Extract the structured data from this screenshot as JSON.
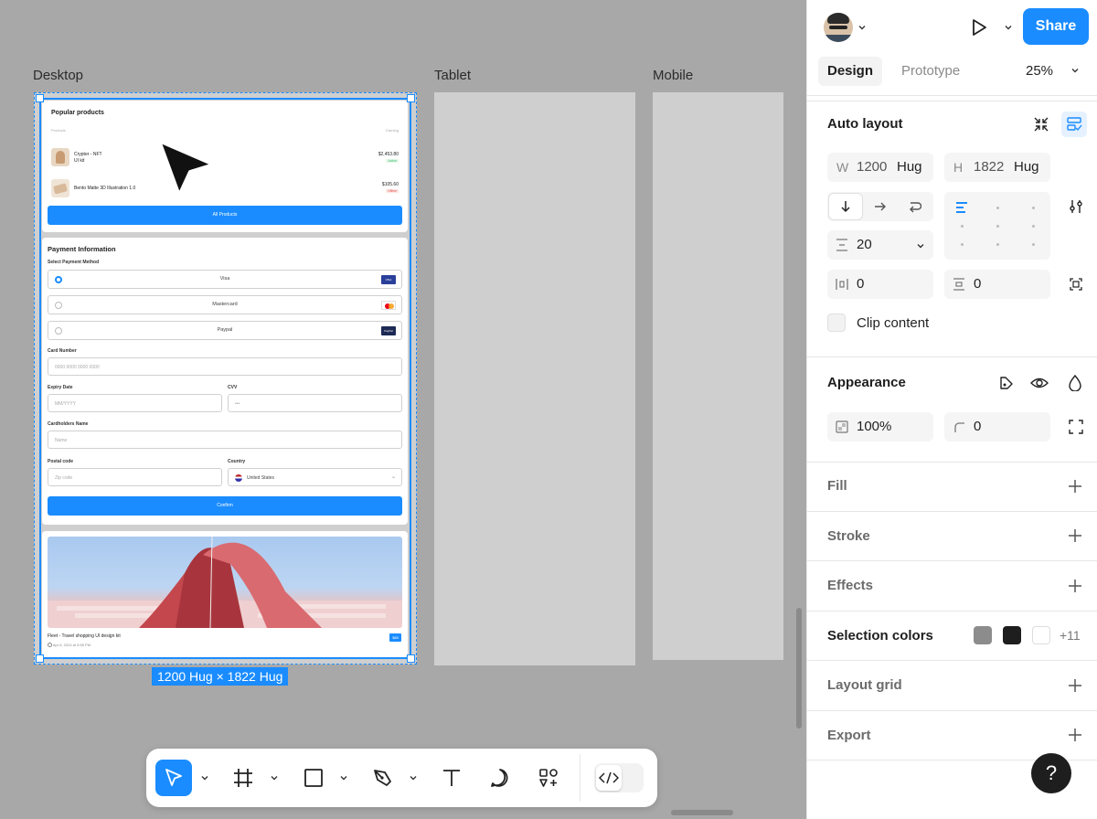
{
  "canvas": {
    "frames": [
      {
        "label": "Desktop"
      },
      {
        "label": "Tablet"
      },
      {
        "label": "Mobile"
      }
    ],
    "selection_size_label": "1200 Hug × 1822 Hug",
    "popular_products": {
      "title": "Popular products",
      "col_products": "Products",
      "col_earning": "Earning",
      "items": [
        {
          "name": "Crypter - NFT",
          "sub": "UI kit",
          "price": "$2,453.80",
          "status": "Active",
          "status_color": "#3dbf6a"
        },
        {
          "name": "Bento Matte 3D Illustration 1.0",
          "sub": "",
          "price": "$105.60",
          "status": "Offline",
          "status_color": "#e5574c"
        }
      ],
      "button": "All Products"
    },
    "payment": {
      "title": "Payment Information",
      "select_label": "Select Payment Method",
      "methods": [
        {
          "label": "Visa",
          "badge": "VISA",
          "badge_color": "#2a3f9a",
          "selected": true
        },
        {
          "label": "Mastercard",
          "badge": "MC",
          "badge_color": "#ffffff",
          "selected": false
        },
        {
          "label": "Paypal",
          "badge": "PayPal",
          "badge_color": "#1c2a55",
          "selected": false
        }
      ],
      "card_number_label": "Card Number",
      "card_number_placeholder": "0000 0000 0000 0000",
      "expiry_label": "Expiry Date",
      "expiry_placeholder": "MM/YYYY",
      "cvv_label": "CVV",
      "cvv_placeholder": "•••",
      "holder_label": "Cardholders Name",
      "holder_placeholder": "Name",
      "postal_label": "Postal code",
      "postal_placeholder": "Zip code",
      "country_label": "Country",
      "country_value": "United States",
      "confirm_button": "Confirm"
    },
    "featured": {
      "caption": "Fleet - Travel shopping UI design kit",
      "date": "Apr 6, 2024 at 3:55 PM",
      "price": "$80"
    }
  },
  "toolbar": {
    "tools": [
      {
        "icon": "move-cursor-icon",
        "active": true
      },
      {
        "icon": "frame-icon",
        "active": false
      },
      {
        "icon": "rectangle-icon",
        "active": false
      },
      {
        "icon": "pen-icon",
        "active": false
      },
      {
        "icon": "text-icon",
        "active": false
      },
      {
        "icon": "comment-icon",
        "active": false
      },
      {
        "icon": "actions-icon",
        "active": false
      },
      {
        "icon": "dev-mode-icon",
        "active": false
      }
    ]
  },
  "panel": {
    "share_label": "Share",
    "tabs": {
      "design": "Design",
      "prototype": "Prototype"
    },
    "zoom": "25%",
    "auto_layout": {
      "title": "Auto layout",
      "width_label": "W",
      "width_value": "1200",
      "width_mode": "Hug",
      "height_label": "H",
      "height_value": "1822",
      "height_mode": "Hug",
      "gap": "20",
      "padding_h": "0",
      "padding_v": "0",
      "clip_label": "Clip content"
    },
    "appearance": {
      "title": "Appearance",
      "opacity": "100%",
      "radius": "0"
    },
    "sections": {
      "fill": "Fill",
      "stroke": "Stroke",
      "effects": "Effects",
      "selection_colors": "Selection colors",
      "layout_grid": "Layout grid",
      "export": "Export"
    },
    "selection_colors": {
      "swatches": [
        "#8c8c8c",
        "#1e1e1e",
        "#ffffff"
      ],
      "more": "+11"
    },
    "help": "?"
  },
  "colors": {
    "accent": "#1a8cff",
    "canvas_bg": "#a8a8a8"
  }
}
